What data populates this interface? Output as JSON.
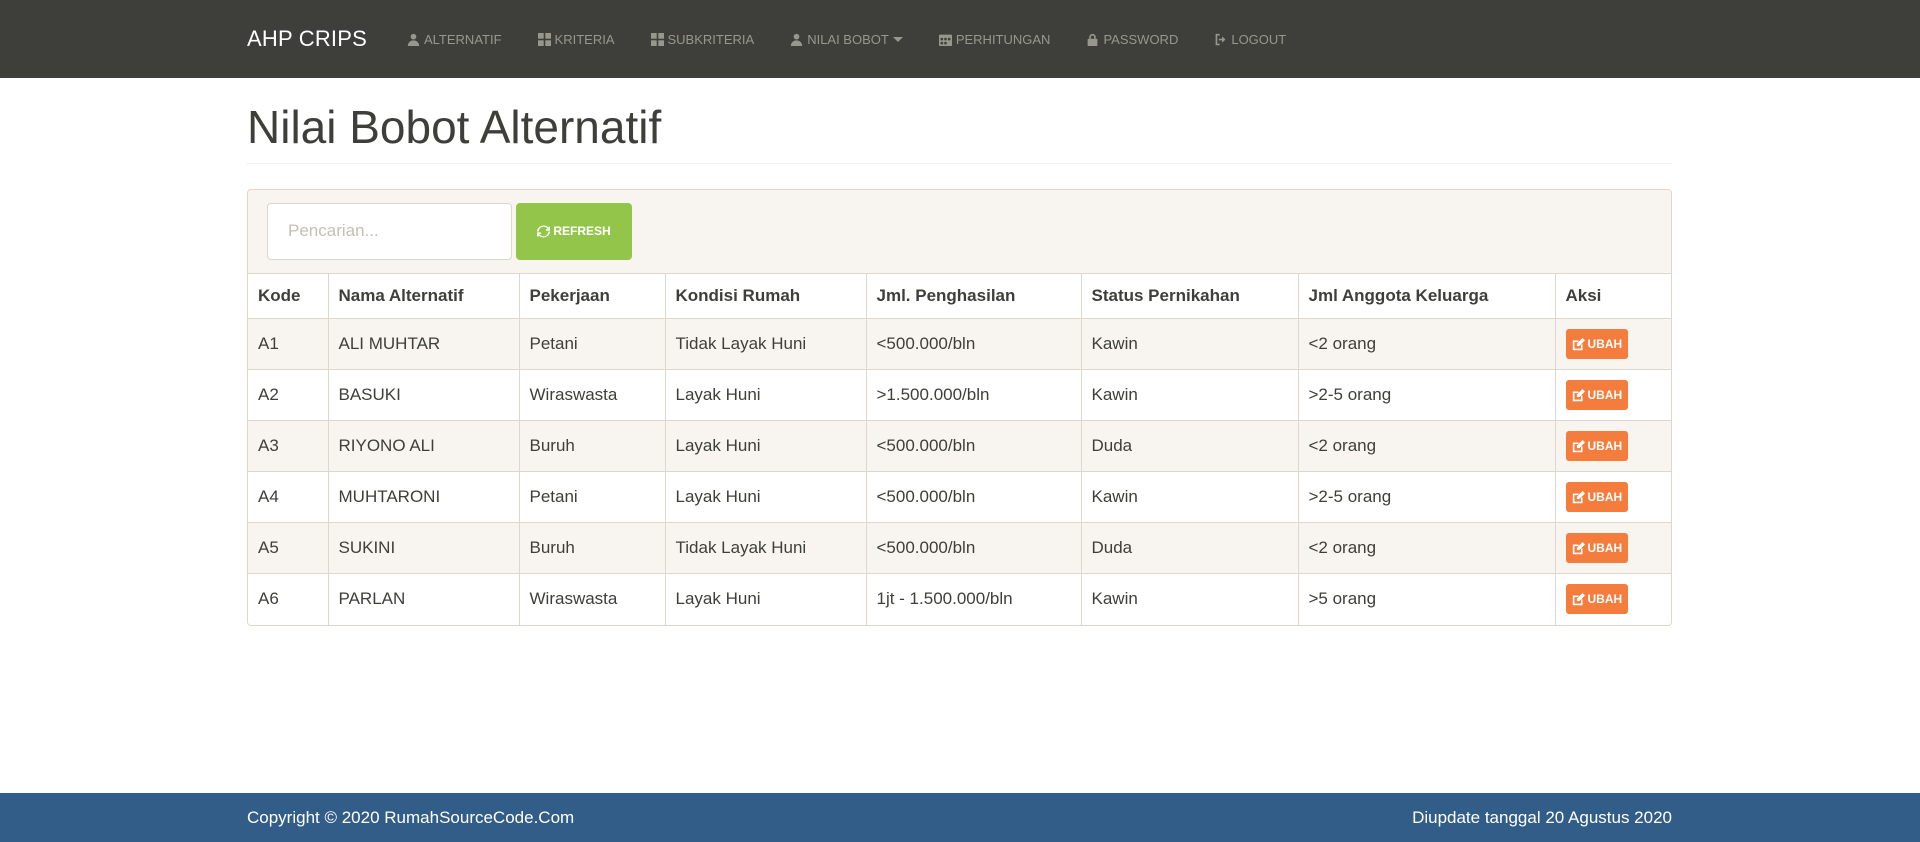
{
  "nav": {
    "brand": "AHP CRIPS",
    "items": [
      {
        "label": "ALTERNATIF",
        "icon": "user-icon"
      },
      {
        "label": "KRITERIA",
        "icon": "grid-icon"
      },
      {
        "label": "SUBKRITERIA",
        "icon": "grid-icon"
      },
      {
        "label": "NILAI BOBOT",
        "icon": "user-icon",
        "dropdown": true
      },
      {
        "label": "PERHITUNGAN",
        "icon": "calendar-icon"
      },
      {
        "label": "PASSWORD",
        "icon": "lock-icon"
      },
      {
        "label": "LOGOUT",
        "icon": "logout-icon"
      }
    ]
  },
  "page": {
    "title": "Nilai Bobot Alternatif"
  },
  "toolbar": {
    "search_placeholder": "Pencarian...",
    "refresh_label": "REFRESH"
  },
  "table": {
    "headers": [
      "Kode",
      "Nama Alternatif",
      "Pekerjaan",
      "Kondisi Rumah",
      "Jml. Penghasilan",
      "Status Pernikahan",
      "Jml Anggota Keluarga",
      "Aksi"
    ],
    "action_label": "UBAH",
    "rows": [
      [
        "A1",
        "ALI MUHTAR",
        "Petani",
        "Tidak Layak Huni",
        "<500.000/bln",
        "Kawin",
        "<2 orang"
      ],
      [
        "A2",
        "BASUKI",
        "Wiraswasta",
        "Layak Huni",
        ">1.500.000/bln",
        "Kawin",
        ">2-5 orang"
      ],
      [
        "A3",
        "RIYONO ALI",
        "Buruh",
        "Layak Huni",
        "<500.000/bln",
        "Duda",
        "<2 orang"
      ],
      [
        "A4",
        "MUHTARONI",
        "Petani",
        "Layak Huni",
        "<500.000/bln",
        "Kawin",
        ">2-5 orang"
      ],
      [
        "A5",
        "SUKINI",
        "Buruh",
        "Tidak Layak Huni",
        "<500.000/bln",
        "Duda",
        "<2 orang"
      ],
      [
        "A6",
        "PARLAN",
        "Wiraswasta",
        "Layak Huni",
        "1jt - 1.500.000/bln",
        "Kawin",
        ">5 orang"
      ]
    ]
  },
  "footer": {
    "copyright": "Copyright © 2020 RumahSourceCode.Com",
    "updated": "Diupdate tanggal 20 Agustus 2020"
  },
  "colors": {
    "navbar": "#3e3f3a",
    "refresh": "#93c54b",
    "ubah": "#f47c3c",
    "footer": "#325d88"
  }
}
